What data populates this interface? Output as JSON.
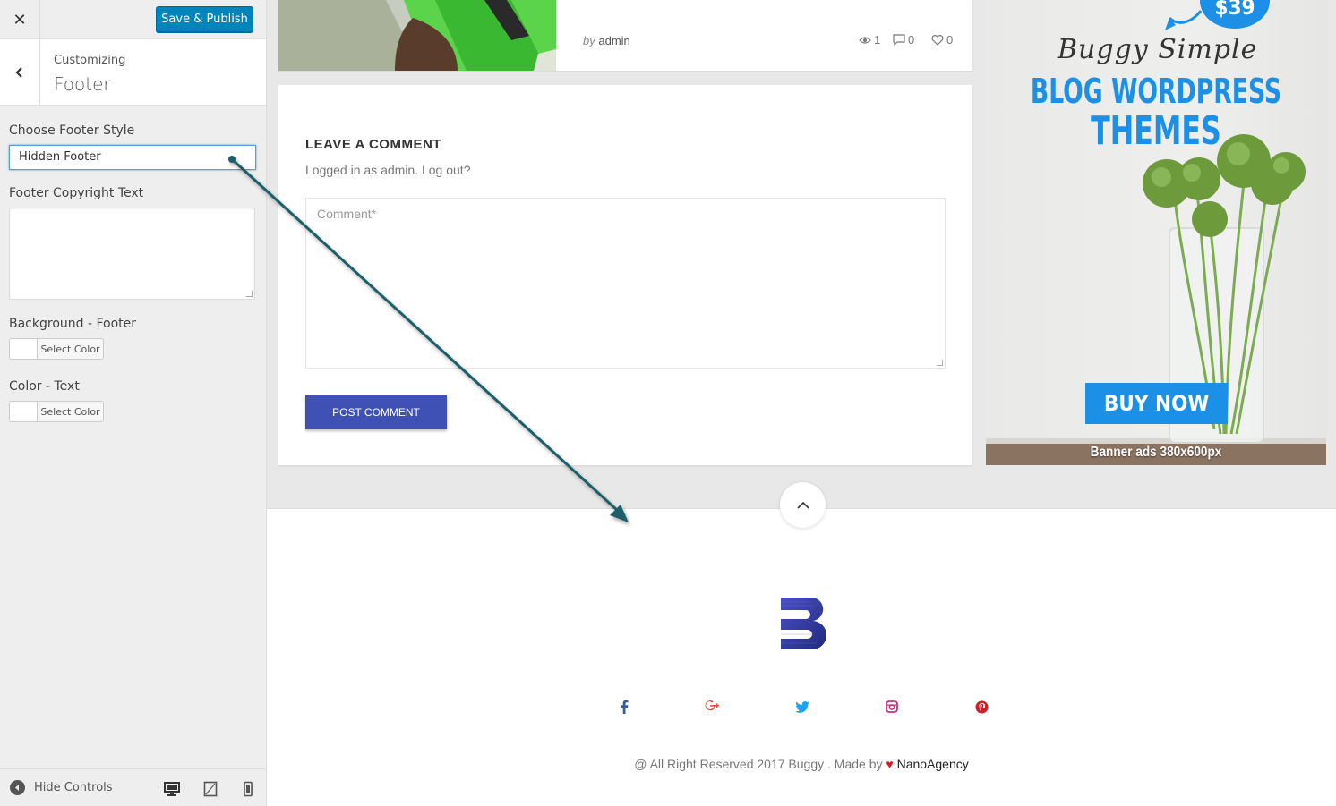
{
  "toolbar": {
    "publish_label": "Save & Publish",
    "close_symbol": "✕"
  },
  "section": {
    "breadcrumb": "Customizing",
    "title": "Footer"
  },
  "controls": {
    "footer_style_label": "Choose Footer Style",
    "footer_style_value": "Hidden Footer",
    "copyright_label": "Footer Copyright Text",
    "bg_footer_label": "Background - Footer",
    "text_color_label": "Color - Text",
    "select_color": "Select Color"
  },
  "bottom_bar": {
    "hide_controls": "Hide Controls"
  },
  "post": {
    "by": "by",
    "author": "admin",
    "views": "1",
    "comments": "0",
    "likes": "0"
  },
  "comment_form": {
    "title": "LEAVE A COMMENT",
    "logged_in": "Logged in as admin. Log out?",
    "placeholder": "Comment*",
    "submit": "POST COMMENT"
  },
  "ad": {
    "price": "$39",
    "script": "Buggy Simple",
    "line1": "BLOG WORDPRESS",
    "line2": "THEMES",
    "buy": "BUY NOW",
    "size": "Banner ads 380x600px"
  },
  "footer": {
    "copyright_prefix": "@ All Right Reserved 2017 Buggy . Made by",
    "heart": "♥",
    "agency": "NanoAgency"
  },
  "colors": {
    "accent": "#0085ba",
    "button_primary": "#3f51b5",
    "ad_blue": "#1c8fe6",
    "arrow": "#1f5f6b",
    "facebook": "#3b5998",
    "googleplus": "#dd4b39",
    "twitter": "#1da1f2",
    "instagram": "#c13584",
    "pinterest": "#cb2027"
  },
  "icons": [
    "close-icon",
    "back-chevron-icon",
    "eye-icon",
    "comment-icon",
    "heart-icon",
    "chevron-up-icon",
    "facebook-icon",
    "google-plus-icon",
    "twitter-icon",
    "instagram-icon",
    "pinterest-icon",
    "desktop-icon",
    "tablet-icon",
    "mobile-icon"
  ]
}
